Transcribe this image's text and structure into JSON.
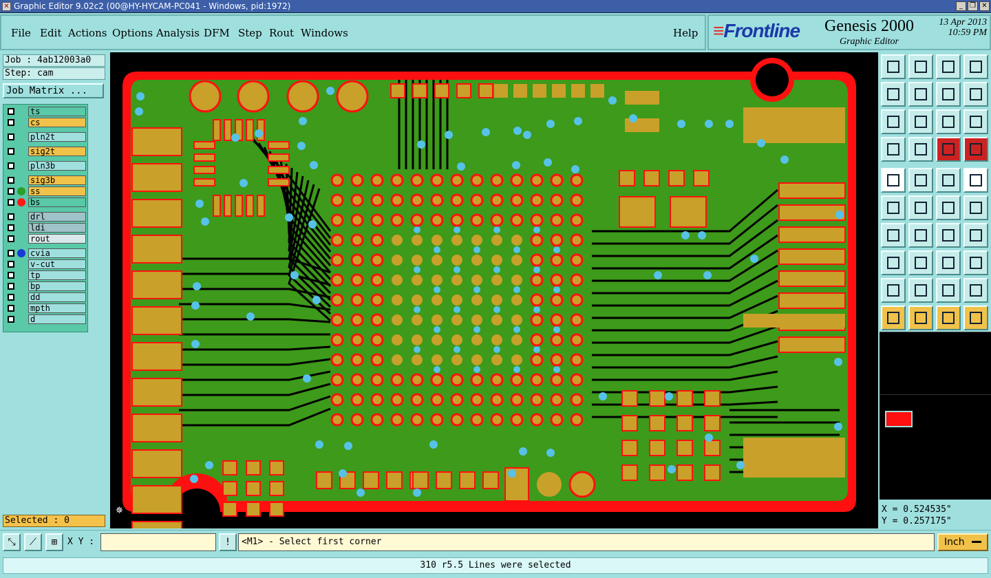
{
  "window": {
    "title": "Graphic Editor 9.02c2 (00@HY-HYCAM-PC041 - Windows, pid:1972)",
    "icon": "app-icon",
    "controls": [
      "minimize-icon",
      "restore-icon",
      "close-icon"
    ]
  },
  "menu": [
    "File",
    "Edit",
    "Actions",
    "Options",
    "Analysis",
    "DFM",
    "Step",
    "Rout",
    "Windows"
  ],
  "help": "Help",
  "brand": {
    "logo_mark": "≡",
    "logo": "Frontline",
    "product": "Genesis 2000",
    "subtitle": "Graphic Editor",
    "date": "13 Apr 2013",
    "time": "10:59 PM"
  },
  "job": {
    "job_label": "Job : 4ab12003a0",
    "step_label": "Step: cam",
    "matrix_button": "Job Matrix ..."
  },
  "layers": [
    {
      "name": "ts",
      "color": "#59c9a8",
      "dot": ""
    },
    {
      "name": "cs",
      "color": "#f1c24a",
      "dot": ""
    },
    {
      "name": "pln2t",
      "color": "#9fe0df",
      "dot": ""
    },
    {
      "name": "sig2t",
      "color": "#f1c24a",
      "dot": ""
    },
    {
      "name": "pln3b",
      "color": "#9fe0df",
      "dot": ""
    },
    {
      "name": "sig3b",
      "color": "#f1c24a",
      "dot": ""
    },
    {
      "name": "ss",
      "color": "#f1c24a",
      "dot": "#2aa02a"
    },
    {
      "name": "bs",
      "color": "#59c9a8",
      "dot": "#ff1a1a"
    },
    {
      "name": "drl",
      "color": "#9fc3c9",
      "dot": ""
    },
    {
      "name": "ldi",
      "color": "#9fc3c9",
      "dot": ""
    },
    {
      "name": "rout",
      "color": "#d9e8ea",
      "dot": ""
    },
    {
      "name": "cvia",
      "color": "#9fe0df",
      "dot": "#1a3ad8"
    },
    {
      "name": "v-cut",
      "color": "#9fe0df",
      "dot": ""
    },
    {
      "name": "tp",
      "color": "#9fe0df",
      "dot": ""
    },
    {
      "name": "bp",
      "color": "#9fe0df",
      "dot": ""
    },
    {
      "name": "dd",
      "color": "#9fe0df",
      "dot": ""
    },
    {
      "name": "mpth",
      "color": "#9fe0df",
      "dot": ""
    },
    {
      "name": "d",
      "color": "#9fe0df",
      "dot": ""
    }
  ],
  "selected": "Selected : 0",
  "coords": {
    "x": "X = 0.524535\"",
    "y": "Y = 0.257175\""
  },
  "command": {
    "xy_label": "X Y :",
    "xy_value": "",
    "prompt": "<M1> - Select first corner",
    "unit": "Inch",
    "warn": "!"
  },
  "status": "310 r5.5 Lines were selected",
  "colors": {
    "board_copper": "#3d9a1a",
    "pad": "#c9a02a",
    "outline": "#ff1010",
    "via": "#57c2e8"
  }
}
